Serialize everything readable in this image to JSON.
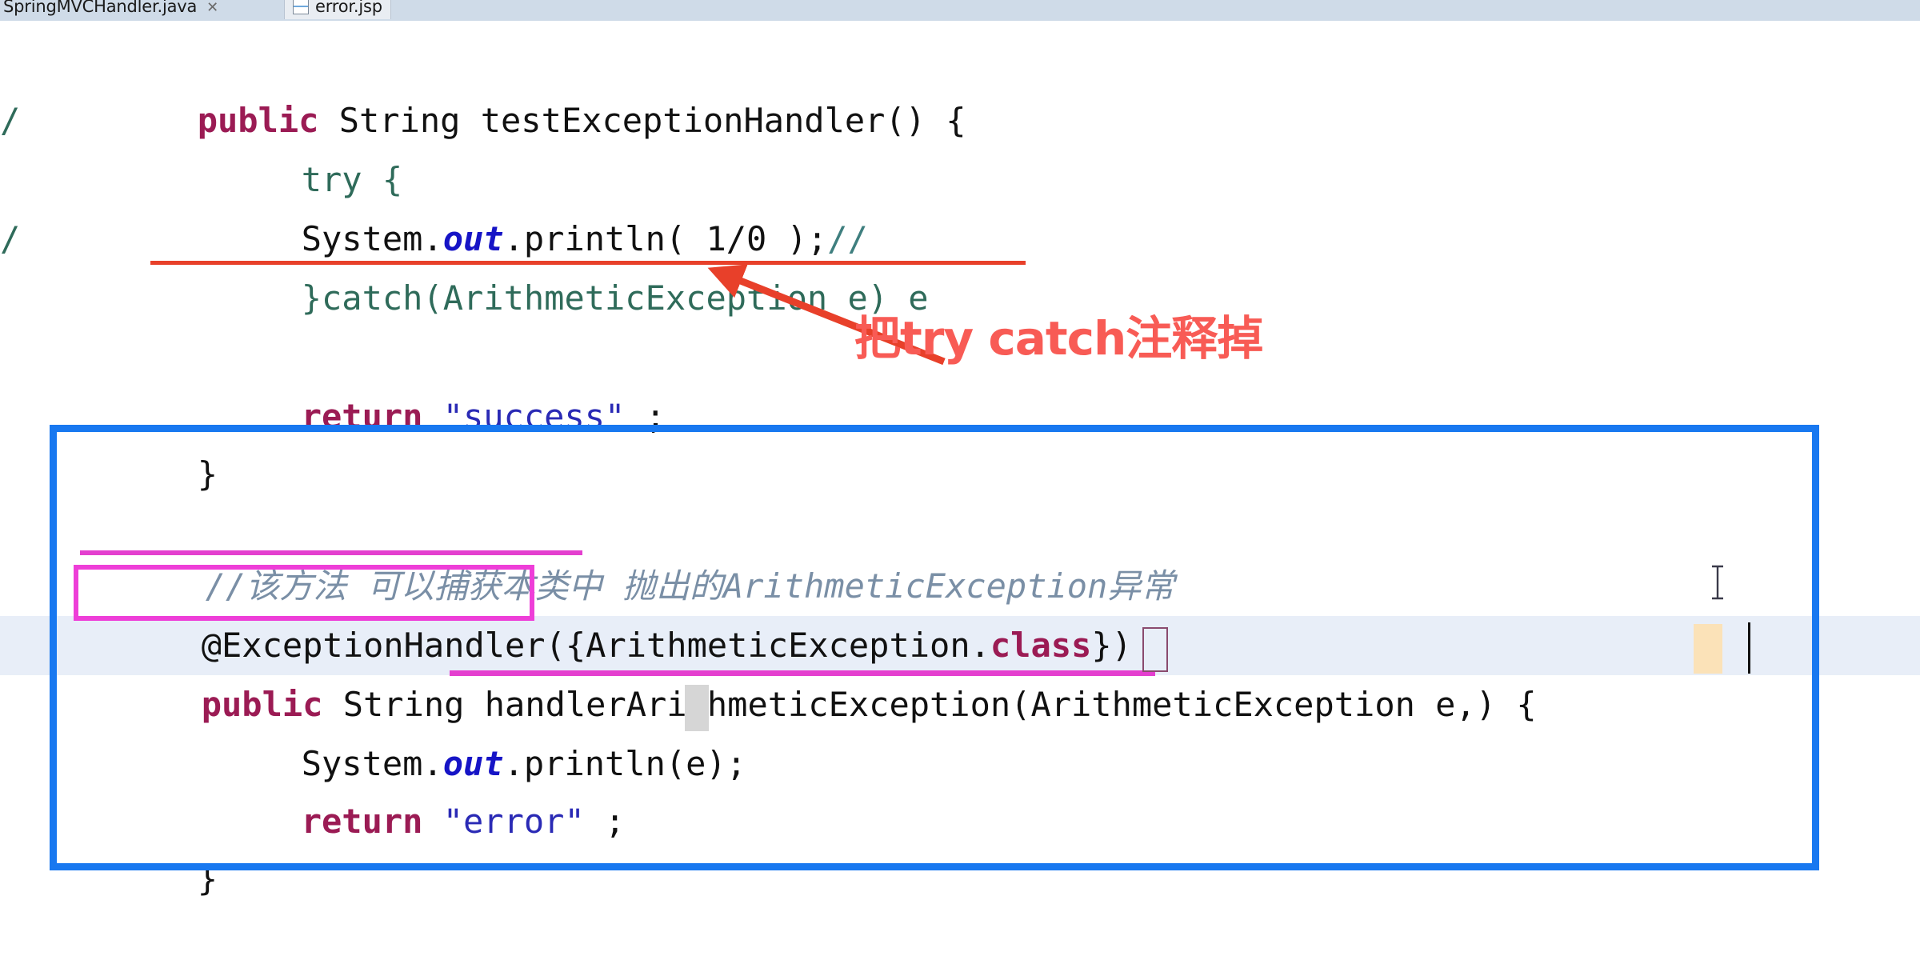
{
  "window": {
    "tabs": [
      {
        "label": "SpringMVCHandler.java",
        "close": "✕",
        "active": false,
        "icon": "java-file-icon"
      },
      {
        "label": "error.jsp",
        "close": "",
        "active": true,
        "icon": "jsp-file-icon"
      }
    ]
  },
  "editor": {
    "gutter_markers": [
      "/",
      "/"
    ],
    "lines": [
      {
        "id": "l1",
        "segments": [
          {
            "text": "public",
            "style": "kw"
          },
          {
            "text": " String testExceptionHandler() {",
            "style": "plain"
          }
        ]
      },
      {
        "id": "l2",
        "segments": [
          {
            "text": "try {",
            "style": "greenline"
          }
        ]
      },
      {
        "id": "l3",
        "segments": [
          {
            "text": "System.",
            "style": "plain"
          },
          {
            "text": "out",
            "style": "fld"
          },
          {
            "text": ".println( 1/0 );",
            "style": "plain"
          },
          {
            "text": "//",
            "style": "com"
          }
        ]
      },
      {
        "id": "l4",
        "segments": [
          {
            "text": "}catch(ArithmeticException e) e",
            "style": "greenline"
          }
        ]
      },
      {
        "id": "l5",
        "segments": [
          {
            "text": "return",
            "style": "kw"
          },
          {
            "text": " ",
            "style": "plain"
          },
          {
            "text": "\"success\"",
            "style": "str"
          },
          {
            "text": " ;",
            "style": "plain"
          }
        ]
      },
      {
        "id": "l6",
        "segments": [
          {
            "text": "}",
            "style": "plain"
          }
        ]
      },
      {
        "id": "l7",
        "segments": [
          {
            "text": "//该方法 可以捕获本类中 抛出的ArithmeticException异常",
            "style": "comGray"
          }
        ]
      },
      {
        "id": "l8",
        "segments": [
          {
            "text": "@ExceptionHandler",
            "style": "plain"
          },
          {
            "text": "({ArithmeticException.",
            "style": "plain"
          },
          {
            "text": "class",
            "style": "kw"
          },
          {
            "text": "})",
            "style": "plain"
          }
        ]
      },
      {
        "id": "l9",
        "segments": [
          {
            "text": "public",
            "style": "kw"
          },
          {
            "text": " String handlerArithmeticException(ArithmeticException e,) {",
            "style": "plain"
          }
        ]
      },
      {
        "id": "l10",
        "segments": [
          {
            "text": "System.",
            "style": "plain"
          },
          {
            "text": "out",
            "style": "fld"
          },
          {
            "text": ".println(e);",
            "style": "plain"
          }
        ]
      },
      {
        "id": "l11",
        "segments": [
          {
            "text": "return",
            "style": "kw"
          },
          {
            "text": " ",
            "style": "plain"
          },
          {
            "text": "\"error\"",
            "style": "str"
          },
          {
            "text": " ;",
            "style": "plain"
          }
        ]
      },
      {
        "id": "l12",
        "segments": [
          {
            "text": "}",
            "style": "plain"
          }
        ]
      }
    ]
  },
  "annotations": {
    "callout_text": "把try catch注释掉",
    "callout_color": "#f85b55",
    "arrow_color": "#e8402a",
    "highlight_box_color": "#1878f0",
    "marker_box_color": "#ee3ed8",
    "error_underline_color": "#e8402a"
  }
}
